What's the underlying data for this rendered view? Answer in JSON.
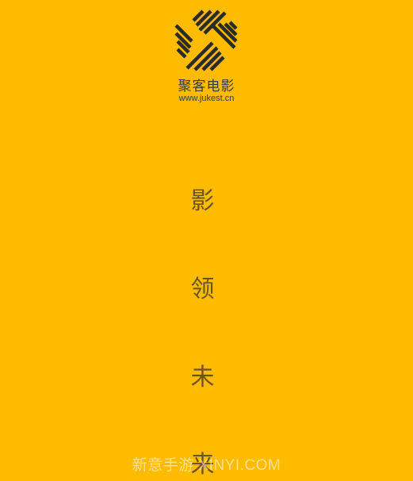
{
  "brand": {
    "logo_icon": "woven-stripes-logo",
    "name": "聚客电影",
    "url": "www.jukest.cn"
  },
  "slogan": {
    "chars": [
      "影",
      "领",
      "未",
      "来"
    ]
  },
  "watermark": {
    "text": "新意手游 XINYI.COM"
  },
  "colors": {
    "background": "#FFBB00",
    "logo": "#2b2b2b",
    "slogan": "#6b5422"
  }
}
